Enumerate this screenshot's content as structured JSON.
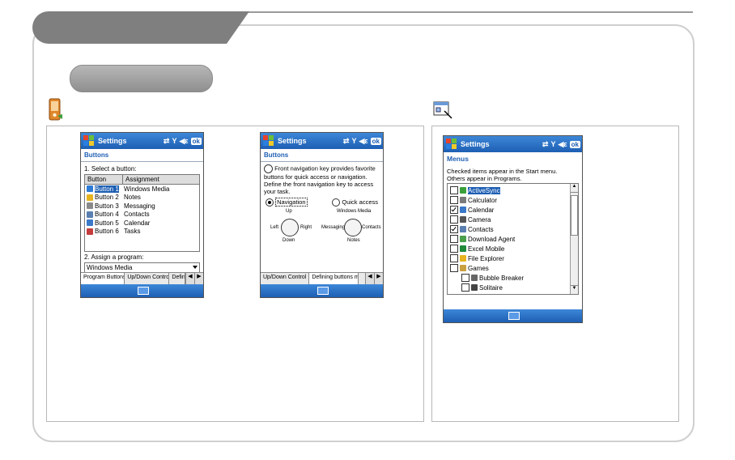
{
  "colors": {
    "title_bar": "#1e5fb3",
    "selection": "#1e5fb3",
    "frame_gray": "#7f7f7f"
  },
  "icons": {
    "left_section": "pda-device-icon",
    "right_section": "settings-window-icon"
  },
  "screen1": {
    "title": "Settings",
    "status_icons": [
      "sync-icon",
      "signal-icon",
      "volume-icon"
    ],
    "ok": "ok",
    "heading": "Buttons",
    "step1": "1. Select a button:",
    "columns": [
      "Button",
      "Assignment"
    ],
    "rows": [
      {
        "button": "Button 1",
        "assignment": "Windows Media",
        "selected": true,
        "icon_color": "#2d7bd6"
      },
      {
        "button": "Button 2",
        "assignment": "Notes",
        "selected": false,
        "icon_color": "#e6b420"
      },
      {
        "button": "Button 3",
        "assignment": "Messaging",
        "selected": false,
        "icon_color": "#8a8a8a"
      },
      {
        "button": "Button 4",
        "assignment": "Contacts",
        "selected": false,
        "icon_color": "#5a7fb0"
      },
      {
        "button": "Button 5",
        "assignment": "Calendar",
        "selected": false,
        "icon_color": "#3a78c8"
      },
      {
        "button": "Button 6",
        "assignment": "Tasks",
        "selected": false,
        "icon_color": "#c43c3c"
      }
    ],
    "step2": "2. Assign a program:",
    "program": "Windows Media",
    "tabs": [
      "Program Buttons",
      "Up/Down Control",
      "Defini"
    ]
  },
  "screen2": {
    "title": "Settings",
    "ok": "ok",
    "heading": "Buttons",
    "description": "Front navigation key provides favorite buttons for quick access or navigation. Define the front navigation key to access your task.",
    "option_navigation": "Navigation",
    "option_quick": "Quick access",
    "pad1": {
      "up": "Up",
      "left": "Left",
      "right": "Right",
      "down": "Down"
    },
    "pad2": {
      "up": "Windows Media",
      "left": "Messaging",
      "right": "Contacts",
      "down": "Notes"
    },
    "tabs": [
      "Up/Down Control",
      "Defining buttons mo"
    ]
  },
  "screen3": {
    "title": "Settings",
    "ok": "ok",
    "heading": "Menus",
    "intro_line1": "Checked items appear in the Start menu.",
    "intro_line2": "Others appear in Programs.",
    "items": [
      {
        "label": "ActiveSync",
        "checked": false,
        "selected": true,
        "indent": 0,
        "icon_color": "#3aa03a"
      },
      {
        "label": "Calculator",
        "checked": false,
        "selected": false,
        "indent": 0,
        "icon_color": "#7a7a7a"
      },
      {
        "label": "Calendar",
        "checked": true,
        "selected": false,
        "indent": 0,
        "icon_color": "#3a78c8"
      },
      {
        "label": "Camera",
        "checked": false,
        "selected": false,
        "indent": 0,
        "icon_color": "#555555"
      },
      {
        "label": "Contacts",
        "checked": true,
        "selected": false,
        "indent": 0,
        "icon_color": "#5a7fb0"
      },
      {
        "label": "Download Agent",
        "checked": false,
        "selected": false,
        "indent": 0,
        "icon_color": "#4aa04a"
      },
      {
        "label": "Excel Mobile",
        "checked": false,
        "selected": false,
        "indent": 0,
        "icon_color": "#1f8a3a"
      },
      {
        "label": "File Explorer",
        "checked": false,
        "selected": false,
        "indent": 0,
        "icon_color": "#e6b420"
      },
      {
        "label": "Games",
        "checked": false,
        "selected": false,
        "indent": 0,
        "icon_color": "#c8a040"
      },
      {
        "label": "Bubble Breaker",
        "checked": false,
        "selected": false,
        "indent": 1,
        "icon_color": "#666666"
      },
      {
        "label": "Solitaire",
        "checked": false,
        "selected": false,
        "indent": 1,
        "icon_color": "#444444"
      }
    ]
  }
}
